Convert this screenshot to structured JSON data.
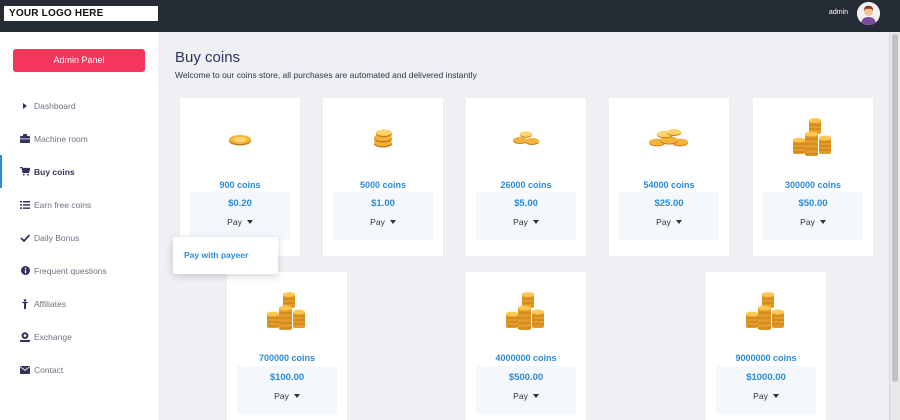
{
  "header": {
    "logo_text": "YOUR LOGO HERE",
    "user_name": "admin"
  },
  "sidebar": {
    "admin_button": "Admin Panel",
    "items": [
      {
        "label": "Dashboard",
        "icon": "chevron-right-icon"
      },
      {
        "label": "Machine room",
        "icon": "machine-icon"
      },
      {
        "label": "Buy coins",
        "icon": "cart-icon",
        "active": true
      },
      {
        "label": "Earn free coins",
        "icon": "list-icon"
      },
      {
        "label": "Daily Bonus",
        "icon": "check-icon"
      },
      {
        "label": "Frequent questions",
        "icon": "info-icon"
      },
      {
        "label": "Affiliates",
        "icon": "affiliate-icon"
      },
      {
        "label": "Exchange",
        "icon": "exchange-icon"
      },
      {
        "label": "Contact",
        "icon": "envelope-icon"
      }
    ]
  },
  "main": {
    "title": "Buy coins",
    "subtitle": "Welcome to our coins store, all purchases are automated and delivered instantly",
    "packages": [
      {
        "coins": "900 coins",
        "price": "$0.20",
        "pay_label": "Pay"
      },
      {
        "coins": "5000 coins",
        "price": "$1.00",
        "pay_label": "Pay"
      },
      {
        "coins": "26000 coins",
        "price": "$5.00",
        "pay_label": "Pay"
      },
      {
        "coins": "54000 coins",
        "price": "$25.00",
        "pay_label": "Pay"
      },
      {
        "coins": "300000 coins",
        "price": "$50.00",
        "pay_label": "Pay"
      },
      {
        "coins": "700000 coins",
        "price": "$100.00",
        "pay_label": "Pay"
      },
      {
        "coins": "4000000 coins",
        "price": "$500.00",
        "pay_label": "Pay"
      },
      {
        "coins": "9000000 coins",
        "price": "$1000.00",
        "pay_label": "Pay"
      }
    ],
    "dropdown": {
      "item": "Pay with payeer"
    }
  },
  "colors": {
    "accent": "#2a8cd8",
    "admin_button": "#f5365c",
    "topbar": "#262c36",
    "background": "#eef0f4"
  }
}
